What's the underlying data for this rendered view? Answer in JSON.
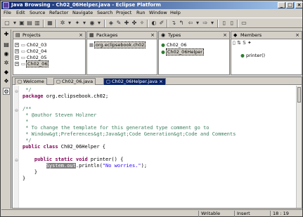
{
  "window": {
    "title": "Java Browsing - Ch02_06Helper.java - Eclipse Platform",
    "controls": [
      "_",
      "□",
      "×"
    ]
  },
  "menu": [
    "File",
    "Edit",
    "Source",
    "Refactor",
    "Navigate",
    "Search",
    "Project",
    "Run",
    "Window",
    "Help"
  ],
  "toolbar_icons": [
    "new-icon",
    "save-icon",
    "print-icon",
    "build-icon",
    "debug-icon",
    "run-icon",
    "new-package-icon",
    "new-class-icon",
    "open-type-icon",
    "search-icon",
    "back-icon",
    "forward-icon"
  ],
  "projects_view": {
    "title": "Projects",
    "items": [
      {
        "label": "Ch02_03",
        "selected": false
      },
      {
        "label": "Ch02_04",
        "selected": false
      },
      {
        "label": "Ch02_05",
        "selected": false
      },
      {
        "label": "Ch02_06",
        "selected": true
      }
    ]
  },
  "packages_view": {
    "title": "Packages",
    "items": [
      {
        "label": "org.eclipsebook.ch02",
        "selected": true
      }
    ]
  },
  "types_view": {
    "title": "Types",
    "items": [
      {
        "label": "Ch02_06",
        "selected": false
      },
      {
        "label": "Ch02_06Helper",
        "selected": true
      }
    ]
  },
  "members_view": {
    "title": "Members",
    "items": [
      {
        "label": "printer()",
        "selected": false
      }
    ]
  },
  "editor": {
    "tabs": [
      {
        "label": "Welcome",
        "active": false
      },
      {
        "label": "Ch02_06.java",
        "active": false
      },
      {
        "label": "Ch02_06Helper.java",
        "active": true
      }
    ],
    "lines": [
      " */",
      "package org.eclipsebook.ch02;",
      "",
      "/**",
      " * @author Steven Holzner",
      " *",
      " * To change the template for this generated type comment go to",
      " * Window&gt;Preferences&gt;Java&gt;Code Generation&gt;Code and Comments",
      " */",
      "public class Ch02_06Helper {",
      "",
      "    public static void printer() {",
      "        System.out.println(\"No worries.\");",
      "    }",
      "}"
    ],
    "highlight": "System.out"
  },
  "status": {
    "writable": "Writable",
    "insert": "Insert",
    "position": "18 : 19"
  }
}
